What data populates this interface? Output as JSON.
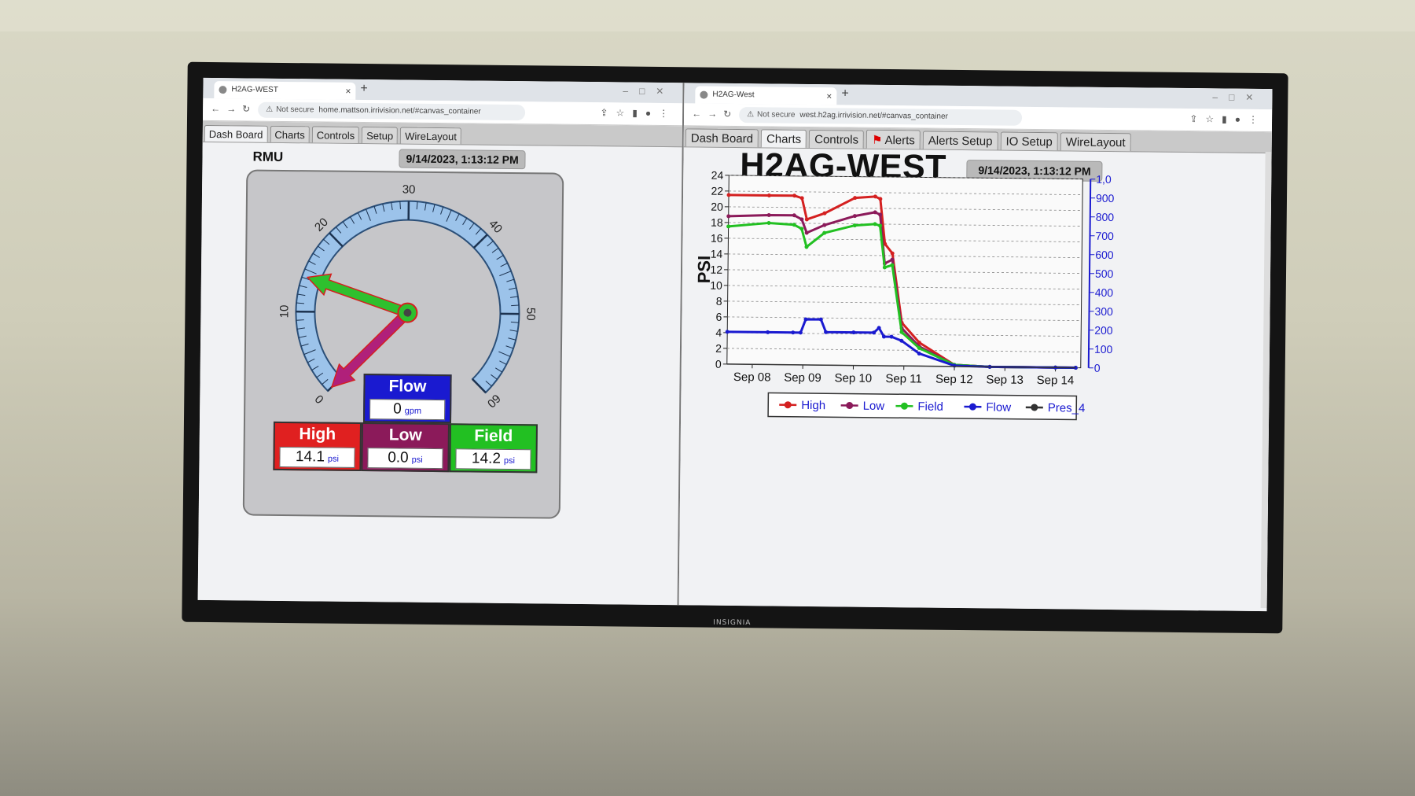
{
  "left_window": {
    "tab_title": "H2AG-WEST",
    "url_warning": "Not secure",
    "url": "home.mattson.irrivision.net/#canvas_container",
    "app_tabs": [
      "Dash Board",
      "Charts",
      "Controls",
      "Setup",
      "WireLayout"
    ],
    "device_label": "RMU",
    "timestamp": "9/14/2023, 1:13:12 PM",
    "gauge": {
      "min": 0,
      "max": 60,
      "tick_labels": [
        "0",
        "10",
        "20",
        "30",
        "40",
        "50",
        "60"
      ],
      "needles": [
        {
          "name": "Field",
          "value": 14.2,
          "color": "#2ec02e"
        },
        {
          "name": "Low",
          "value": 0.0,
          "color": "#b0207a"
        }
      ]
    },
    "readouts": {
      "flow": {
        "label": "Flow",
        "value": "0",
        "unit": "gpm",
        "color": "#1a1ad0"
      },
      "high": {
        "label": "High",
        "value": "14.1",
        "unit": "psi",
        "color": "#e02020"
      },
      "low": {
        "label": "Low",
        "value": "0.0",
        "unit": "psi",
        "color": "#8b1a5a"
      },
      "field": {
        "label": "Field",
        "value": "14.2",
        "unit": "psi",
        "color": "#22c022"
      }
    }
  },
  "right_window": {
    "tab_title": "H2AG-West",
    "url_warning": "Not secure",
    "url": "west.h2ag.irrivision.net/#canvas_container",
    "app_tabs": [
      "Dash Board",
      "Charts",
      "Controls",
      "Alerts",
      "Alerts Setup",
      "IO Setup",
      "WireLayout"
    ],
    "title": "H2AG-WEST",
    "timestamp": "9/14/2023, 1:13:12 PM"
  },
  "tv_brand": "INSIGNIA",
  "chart_data": {
    "type": "line",
    "title": "H2AG-WEST",
    "ylabel": "PSI",
    "ylim": [
      0,
      24
    ],
    "y_ticks": [
      "0",
      "2",
      "4",
      "6",
      "8",
      "10",
      "12",
      "14",
      "16",
      "18",
      "20",
      "22",
      "24"
    ],
    "y2lim": [
      0,
      1000
    ],
    "y2_ticks": [
      "0",
      "100",
      "200",
      "300",
      "400",
      "500",
      "600",
      "700",
      "800",
      "900",
      "1,0"
    ],
    "x_ticks": [
      "Sep 08",
      "Sep 09",
      "Sep 10",
      "Sep 11",
      "Sep 12",
      "Sep 13",
      "Sep 14"
    ],
    "xlim": [
      0,
      7
    ],
    "grid": true,
    "legend_position": "bottom",
    "series": [
      {
        "name": "High",
        "color": "#d42020",
        "x": [
          0,
          0.8,
          1.3,
          1.45,
          1.55,
          1.9,
          2.5,
          2.9,
          3.0,
          3.1,
          3.25,
          3.45,
          3.8,
          4.5,
          5.2,
          6.5,
          6.9
        ],
        "y": [
          21.5,
          21.5,
          21.5,
          21.2,
          18.5,
          19.3,
          21.3,
          21.5,
          21.2,
          15.5,
          14.3,
          5.5,
          3.0,
          0.2,
          0,
          0,
          0
        ]
      },
      {
        "name": "Low",
        "color": "#8b1a5a",
        "x": [
          0,
          0.8,
          1.3,
          1.45,
          1.55,
          1.9,
          2.5,
          2.9,
          3.0,
          3.1,
          3.25,
          3.45,
          3.8,
          4.5,
          5.2,
          6.5,
          6.9
        ],
        "y": [
          18.8,
          19.0,
          19.0,
          18.5,
          16.8,
          17.8,
          19.0,
          19.5,
          19.2,
          13.0,
          13.5,
          4.8,
          2.5,
          0.2,
          0,
          0,
          0
        ]
      },
      {
        "name": "Field",
        "color": "#22c022",
        "x": [
          0,
          0.8,
          1.3,
          1.45,
          1.55,
          1.9,
          2.5,
          2.9,
          3.0,
          3.1,
          3.25,
          3.45,
          3.8,
          4.5,
          5.2,
          6.5,
          6.9
        ],
        "y": [
          17.5,
          18.0,
          17.8,
          17.3,
          15.0,
          16.8,
          17.8,
          18.0,
          17.8,
          12.5,
          12.8,
          4.3,
          2.3,
          0.2,
          0,
          0,
          0
        ]
      },
      {
        "name": "Flow",
        "color": "#1a1ad0",
        "x": [
          0,
          0.8,
          1.3,
          1.45,
          1.55,
          1.85,
          1.95,
          2.5,
          2.9,
          3.0,
          3.1,
          3.25,
          3.45,
          3.8,
          4.5,
          5.2,
          6.5,
          6.9
        ],
        "y": [
          4.1,
          4.1,
          4.1,
          4.1,
          5.8,
          5.8,
          4.2,
          4.2,
          4.2,
          4.8,
          3.7,
          3.7,
          3.2,
          1.6,
          0.1,
          0,
          0,
          0
        ]
      },
      {
        "name": "Pres_4",
        "color": "#333333",
        "x": [
          0,
          6.9
        ],
        "y": [
          0,
          0
        ]
      }
    ]
  }
}
